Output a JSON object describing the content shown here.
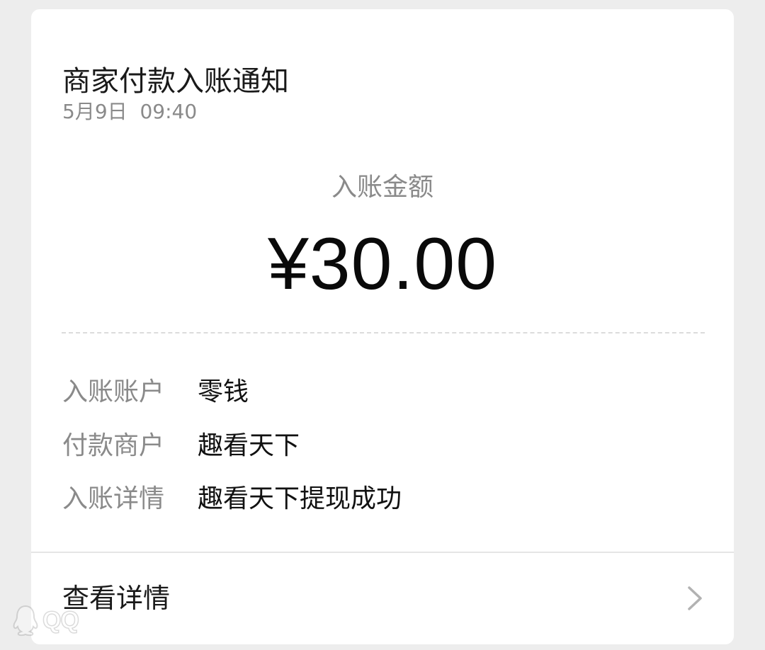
{
  "notification": {
    "title": "商家付款入账通知",
    "date": "5月9日",
    "time": "09:40"
  },
  "amount": {
    "label": "入账金额",
    "value": "¥30.00"
  },
  "details": [
    {
      "key": "入账账户",
      "value": "零钱"
    },
    {
      "key": "付款商户",
      "value": "趣看天下"
    },
    {
      "key": "入账详情",
      "value": "趣看天下提现成功"
    }
  ],
  "footer": {
    "label": "查看详情",
    "icon": "chevron-right-icon"
  },
  "watermark": {
    "text": "QQ",
    "icon": "qq-penguin-icon"
  },
  "colors": {
    "background": "#ededed",
    "card": "#ffffff",
    "secondary_text": "#8a8a8a",
    "primary_text": "#191919"
  }
}
